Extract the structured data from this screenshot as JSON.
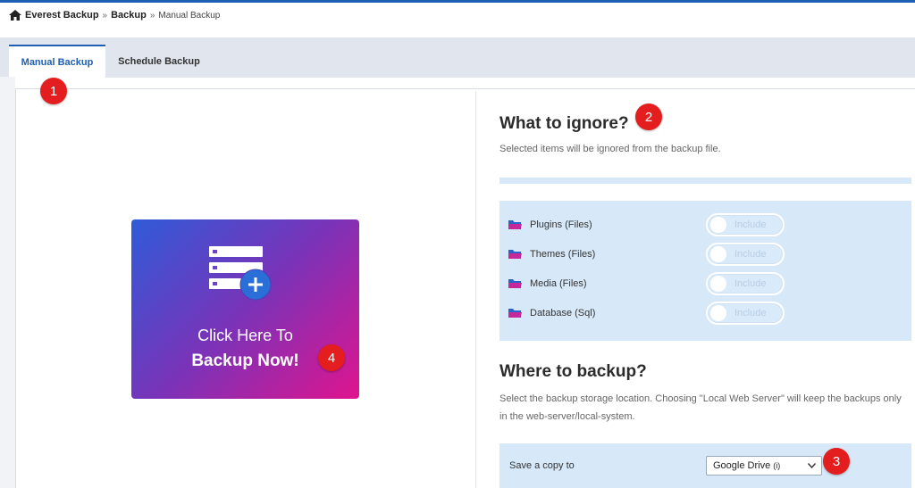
{
  "breadcrumb": {
    "home_icon": "home-icon",
    "items": [
      "Everest Backup",
      "Backup",
      "Manual Backup"
    ],
    "separator": "»"
  },
  "tabs": [
    {
      "label": "Manual Backup",
      "active": true
    },
    {
      "label": "Schedule Backup",
      "active": false
    }
  ],
  "backup_card": {
    "icon": "server-add-icon",
    "line1": "Click Here To",
    "line2": "Backup Now!"
  },
  "ignore_section": {
    "title": "What to ignore?",
    "description": "Selected items will be ignored from the backup file.",
    "items": [
      {
        "label": "Plugins (Files)",
        "toggle_label": "Include"
      },
      {
        "label": "Themes (Files)",
        "toggle_label": "Include"
      },
      {
        "label": "Media (Files)",
        "toggle_label": "Include"
      },
      {
        "label": "Database (Sql)",
        "toggle_label": "Include"
      }
    ]
  },
  "where_section": {
    "title": "Where to backup?",
    "description": "Select the backup storage location. Choosing \"Local Web Server\" will keep the backups only in the web-server/local-system.",
    "save_label": "Save a copy to",
    "selected_option": "Google Drive",
    "selected_option_info": "(i)"
  },
  "annotations": [
    "1",
    "2",
    "3",
    "4"
  ],
  "colors": {
    "accent": "#1f5fb5",
    "badge": "#e41e1e",
    "panel_bg": "#d7e8f8",
    "card_gradient_start": "#2f5bd8",
    "card_gradient_end": "#e0148e"
  }
}
